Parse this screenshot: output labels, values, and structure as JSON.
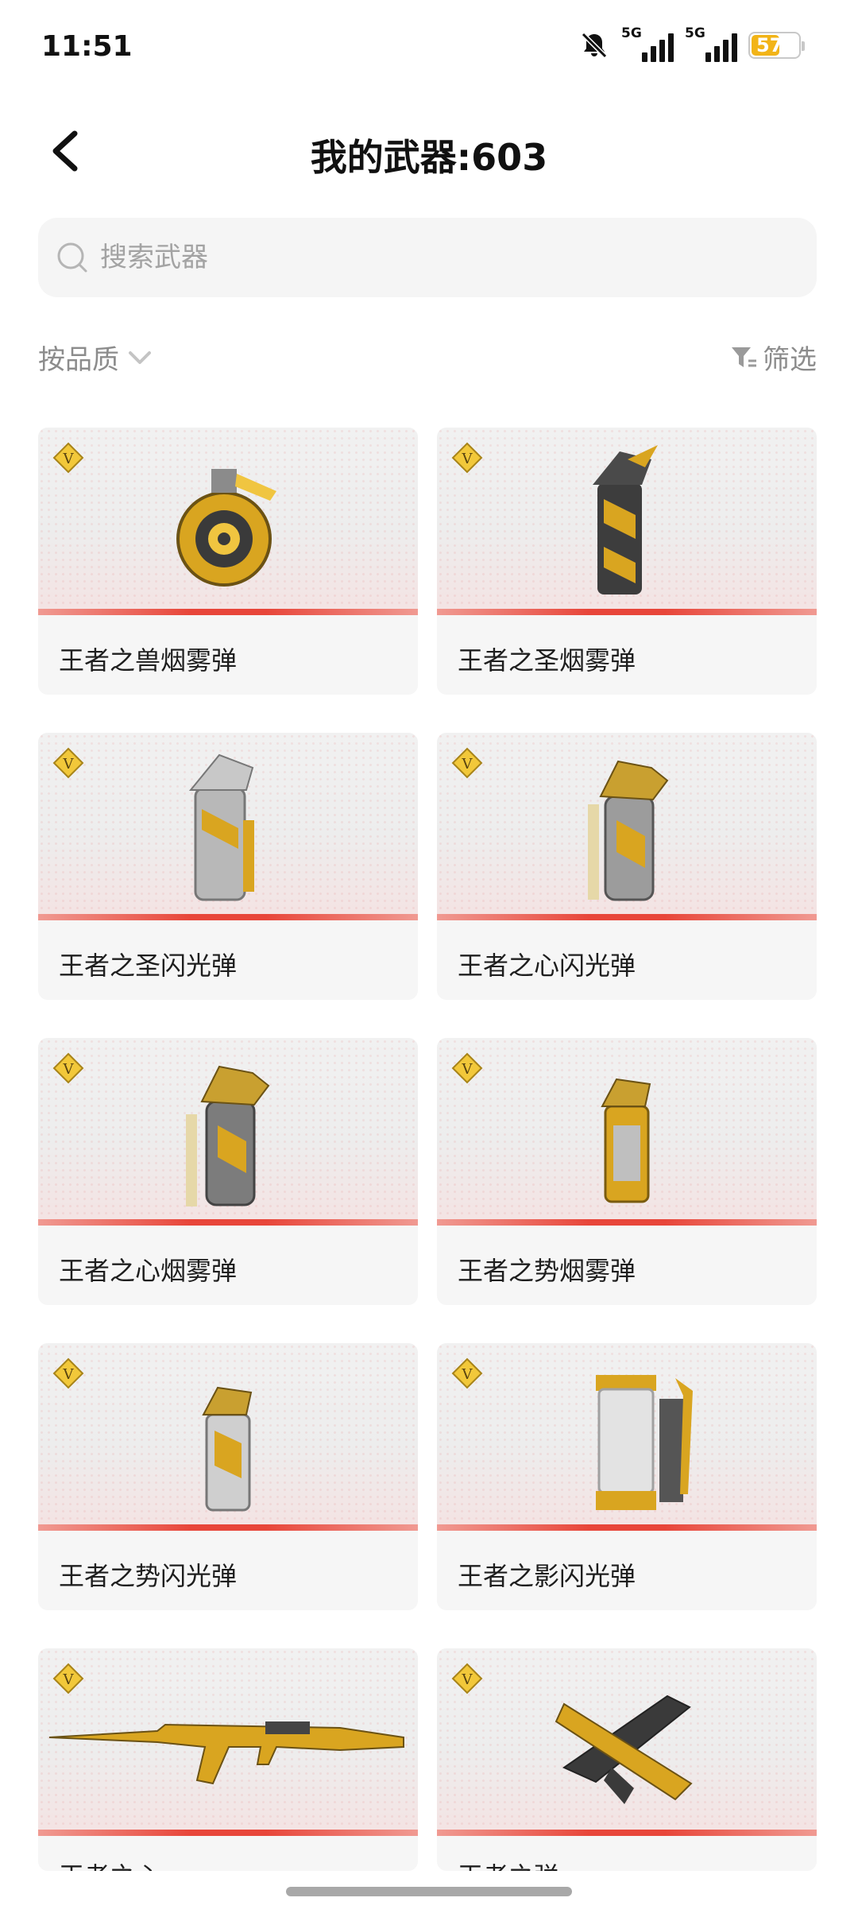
{
  "status": {
    "time": "11:51",
    "network1": "5G",
    "network2": "5G",
    "battery": "57",
    "battery_fraction": 0.57,
    "icons": [
      "bell-muted-icon",
      "signal-icon",
      "signal-icon",
      "battery-icon"
    ]
  },
  "header": {
    "title": "我的武器:603",
    "back_icon": "chevron-left-icon"
  },
  "search": {
    "placeholder": "搜索武器",
    "value": "",
    "icon": "search-icon"
  },
  "toolbar": {
    "sort_label": "按品质",
    "sort_icon": "chevron-down-icon",
    "filter_label": "筛选",
    "filter_icon": "filter-icon"
  },
  "weapons": [
    {
      "name": "王者之兽烟雾弹",
      "type": "grenade-round"
    },
    {
      "name": "王者之圣烟雾弹",
      "type": "canister"
    },
    {
      "name": "王者之圣闪光弹",
      "type": "canister"
    },
    {
      "name": "王者之心闪光弹",
      "type": "canister-lion"
    },
    {
      "name": "王者之心烟雾弹",
      "type": "canister-lion"
    },
    {
      "name": "王者之势烟雾弹",
      "type": "canister-small"
    },
    {
      "name": "王者之势闪光弹",
      "type": "canister-small"
    },
    {
      "name": "王者之影闪光弹",
      "type": "canister-clear"
    },
    {
      "name": "王者之心",
      "type": "rifle"
    },
    {
      "name": "王者之弹",
      "type": "pistol"
    }
  ],
  "colors": {
    "accent_gold": "#d9a520",
    "rarity_red": "#e8463a",
    "battery_yellow": "#f2b418"
  }
}
